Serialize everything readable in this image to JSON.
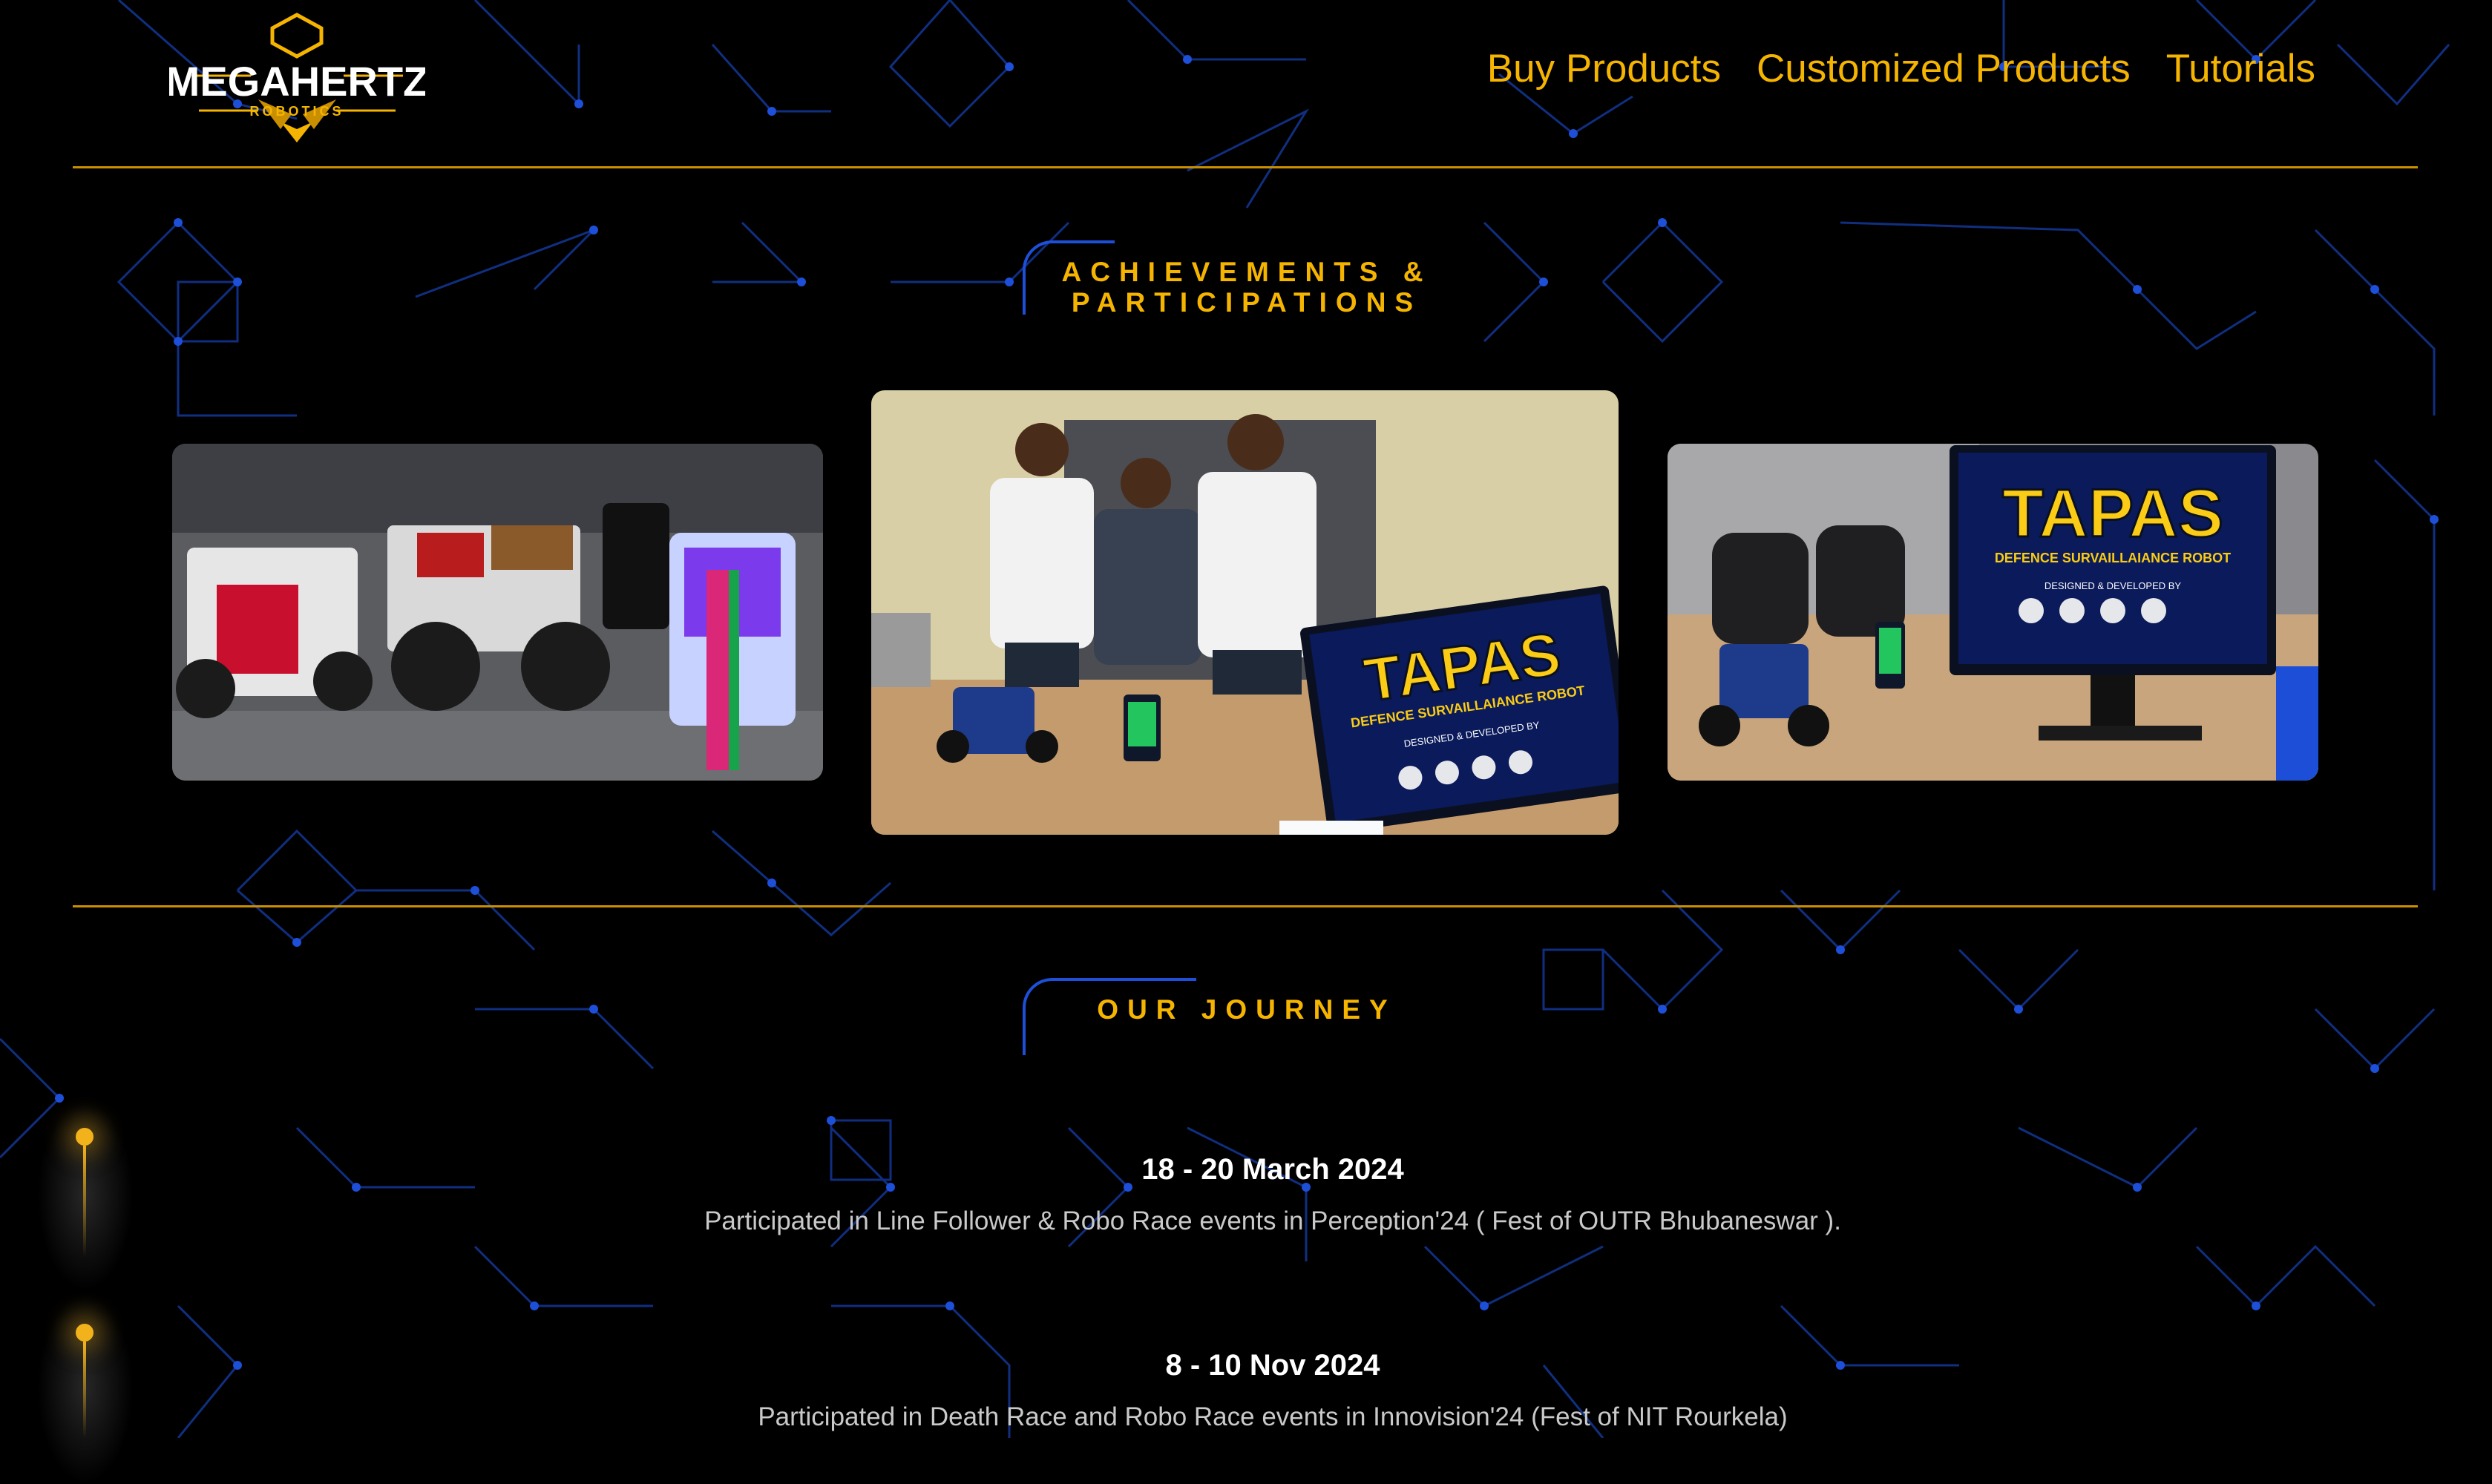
{
  "brand": {
    "name": "MEGAHERTZ",
    "tagline": "ROBOTICS"
  },
  "nav": {
    "items": [
      {
        "label": "Buy Products"
      },
      {
        "label": "Customized Products"
      },
      {
        "label": "Tutorials"
      }
    ]
  },
  "achievements": {
    "title_line1": "ACHIEVEMENTS &",
    "title_line2": "PARTICIPATIONS",
    "photos": [
      {
        "screen_title": ""
      },
      {
        "screen_title": "TAPAS",
        "screen_subtitle": "DEFENCE SURVAILLAIANCE ROBOT",
        "screen_credit": "DESIGNED & DEVELOPED BY"
      },
      {
        "screen_title": "TAPAS",
        "screen_subtitle": "DEFENCE SURVAILLAIANCE ROBOT",
        "screen_credit": "DESIGNED & DEVELOPED BY"
      }
    ]
  },
  "journey": {
    "title": "OUR JOURNEY",
    "events": [
      {
        "date": "18 - 20 March 2024",
        "description": "Participated in  Line Follower & Robo Race events in Perception'24 ( Fest of OUTR Bhubaneswar )."
      },
      {
        "date": "8 - 10 Nov 2024",
        "description": "Participated in Death Race and Robo Race events in Innovision'24 (Fest of NIT Rourkela)"
      }
    ]
  },
  "colors": {
    "accent": "#f5b400",
    "rule": "#c98f00",
    "grid": "#1d4fd8",
    "background": "#000000"
  }
}
